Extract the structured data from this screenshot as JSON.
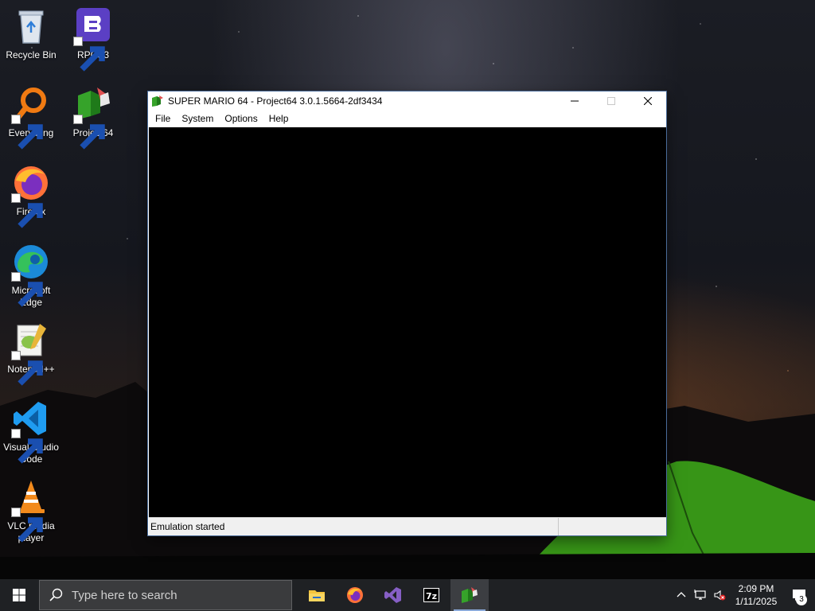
{
  "desktop": {
    "icons": [
      {
        "label": "Recycle Bin",
        "icon": "recycle-bin-icon"
      },
      {
        "label": "RPCS3",
        "icon": "rpcs3-icon"
      },
      {
        "label": "Everything",
        "icon": "everything-search-icon"
      },
      {
        "label": "Project64",
        "icon": "project64-icon"
      },
      {
        "label": "Firefox",
        "icon": "firefox-icon"
      },
      {
        "label": "Microsoft Edge",
        "icon": "edge-icon"
      },
      {
        "label": "Notepad++",
        "icon": "notepad-plus-plus-icon"
      },
      {
        "label": "Visual Studio Code",
        "icon": "vscode-icon"
      },
      {
        "label": "VLC media player",
        "icon": "vlc-icon"
      }
    ]
  },
  "window": {
    "title": "SUPER MARIO 64 - Project64 3.0.1.5664-2df3434",
    "menu": [
      "File",
      "System",
      "Options",
      "Help"
    ],
    "status": "Emulation started"
  },
  "taskbar": {
    "search_placeholder": "Type here to search",
    "apps": [
      "file-explorer-icon",
      "firefox-icon",
      "visual-studio-icon",
      "7zip-icon",
      "project64-icon"
    ],
    "time": "2:09 PM",
    "date": "1/11/2025",
    "notification_count": "3"
  },
  "colors": {
    "taskbar": "#1f2124",
    "window_title_bg": "#ffffff",
    "canvas": "#000000",
    "statusbar": "#f0f0f0",
    "active_underline": "#8aa8d8"
  }
}
